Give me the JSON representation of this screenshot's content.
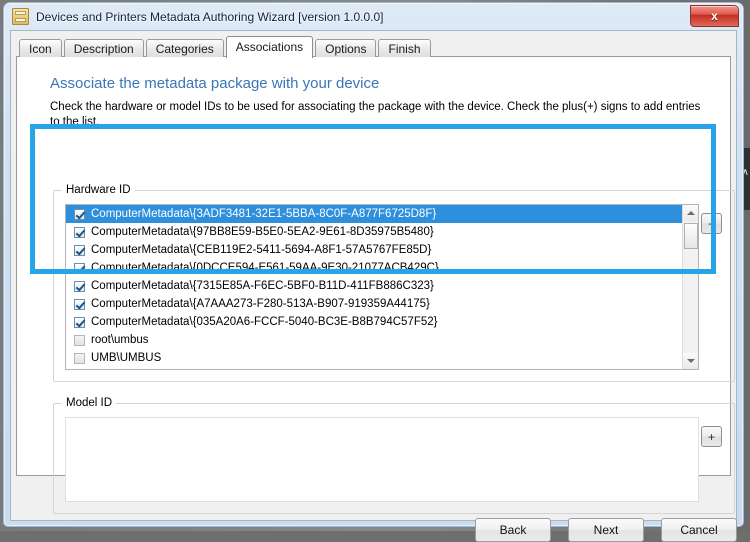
{
  "window": {
    "title": "Devices and Printers Metadata Authoring Wizard [version 1.0.0.0]",
    "icon": "document-icon",
    "close_label": "x",
    "close_icon": "close-icon"
  },
  "tabs": [
    {
      "label": "Icon",
      "active": false
    },
    {
      "label": "Description",
      "active": false
    },
    {
      "label": "Categories",
      "active": false
    },
    {
      "label": "Associations",
      "active": true
    },
    {
      "label": "Options",
      "active": false
    },
    {
      "label": "Finish",
      "active": false
    }
  ],
  "page": {
    "heading": "Associate the metadata package with your device",
    "subtext": "Check the hardware or model IDs to be used for associating the package with the device. Check the plus(+) signs to add entries to the list."
  },
  "hardware_group": {
    "label": "Hardware ID",
    "add_button_label": "+",
    "add_button_icon": "plus-icon",
    "scrollbar": {
      "up_icon": "chevron-up-icon",
      "down_icon": "chevron-down-icon"
    },
    "items": [
      {
        "label": "ComputerMetadata\\{3ADF3481-32E1-5BBA-8C0F-A877F6725D8F}",
        "checked": true,
        "selected": true,
        "enabled": true
      },
      {
        "label": "ComputerMetadata\\{97BB8E59-B5E0-5EA2-9E61-8D35975B5480}",
        "checked": true,
        "selected": false,
        "enabled": true
      },
      {
        "label": "ComputerMetadata\\{CEB119E2-5411-5694-A8F1-57A5767FE85D}",
        "checked": true,
        "selected": false,
        "enabled": true
      },
      {
        "label": "ComputerMetadata\\{0DCCE594-E561-59AA-9E30-21077ACB429C}",
        "checked": true,
        "selected": false,
        "enabled": true
      },
      {
        "label": "ComputerMetadata\\{7315E85A-F6EC-5BF0-B11D-411FB886C323}",
        "checked": true,
        "selected": false,
        "enabled": true
      },
      {
        "label": "ComputerMetadata\\{A7AAA273-F280-513A-B907-919359A44175}",
        "checked": true,
        "selected": false,
        "enabled": true
      },
      {
        "label": "ComputerMetadata\\{035A20A6-FCCF-5040-BC3E-B8B794C57F52}",
        "checked": true,
        "selected": false,
        "enabled": true
      },
      {
        "label": "root\\umbus",
        "checked": false,
        "selected": false,
        "enabled": false
      },
      {
        "label": "UMB\\UMBUS",
        "checked": false,
        "selected": false,
        "enabled": false
      }
    ]
  },
  "model_group": {
    "label": "Model ID",
    "add_button_label": "+",
    "add_button_icon": "plus-icon",
    "items": []
  },
  "footer": {
    "back_label": "Back",
    "next_label": "Next",
    "cancel_label": "Cancel"
  },
  "annotation": {
    "color": "#27a4e8",
    "kind": "highlight-rectangle"
  },
  "colors": {
    "selection_blue": "#2e8fdd",
    "heading_blue": "#3a76b8",
    "annotation_blue": "#27a4e8",
    "close_red": "#c22e21"
  }
}
